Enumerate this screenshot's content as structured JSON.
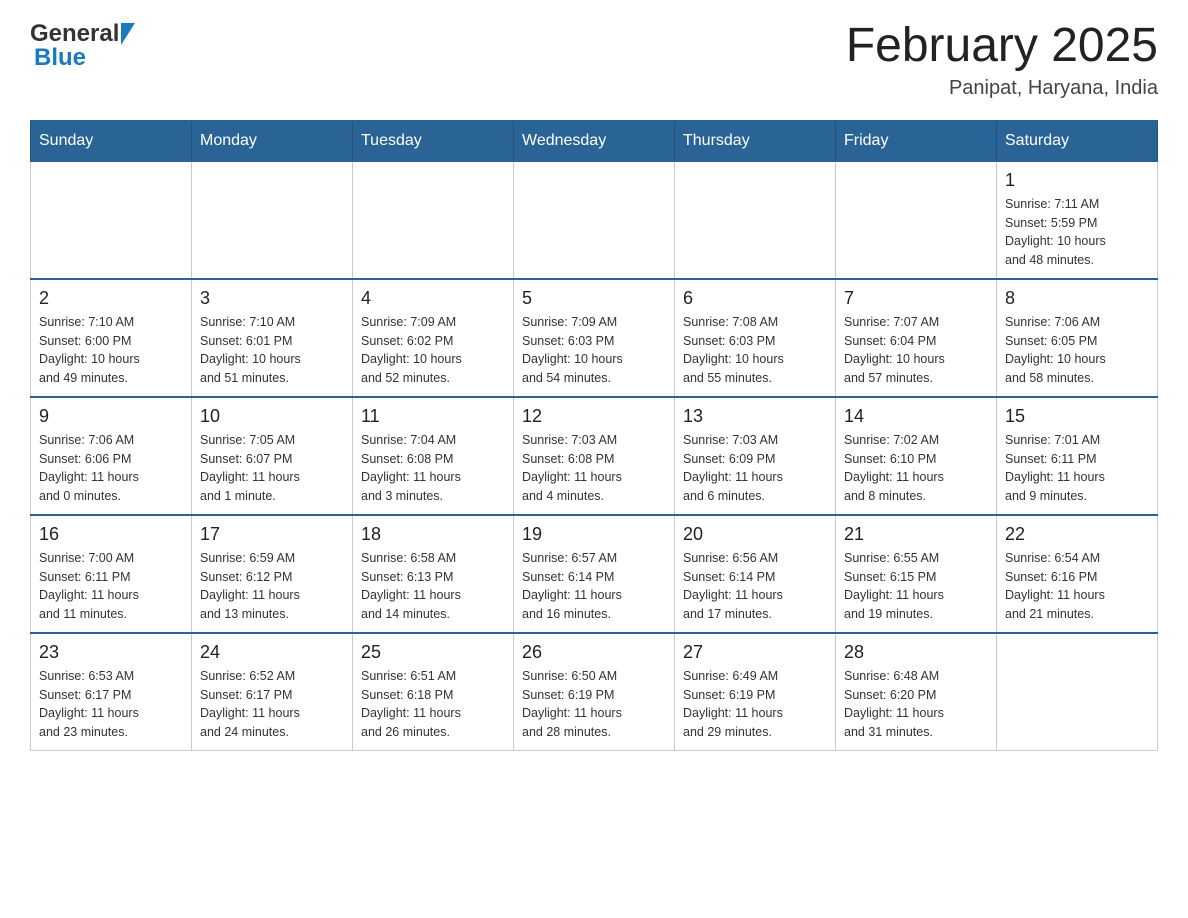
{
  "header": {
    "logo": {
      "general": "General",
      "blue": "Blue"
    },
    "title": "February 2025",
    "location": "Panipat, Haryana, India"
  },
  "weekdays": [
    "Sunday",
    "Monday",
    "Tuesday",
    "Wednesday",
    "Thursday",
    "Friday",
    "Saturday"
  ],
  "weeks": [
    [
      {
        "day": "",
        "info": ""
      },
      {
        "day": "",
        "info": ""
      },
      {
        "day": "",
        "info": ""
      },
      {
        "day": "",
        "info": ""
      },
      {
        "day": "",
        "info": ""
      },
      {
        "day": "",
        "info": ""
      },
      {
        "day": "1",
        "info": "Sunrise: 7:11 AM\nSunset: 5:59 PM\nDaylight: 10 hours\nand 48 minutes."
      }
    ],
    [
      {
        "day": "2",
        "info": "Sunrise: 7:10 AM\nSunset: 6:00 PM\nDaylight: 10 hours\nand 49 minutes."
      },
      {
        "day": "3",
        "info": "Sunrise: 7:10 AM\nSunset: 6:01 PM\nDaylight: 10 hours\nand 51 minutes."
      },
      {
        "day": "4",
        "info": "Sunrise: 7:09 AM\nSunset: 6:02 PM\nDaylight: 10 hours\nand 52 minutes."
      },
      {
        "day": "5",
        "info": "Sunrise: 7:09 AM\nSunset: 6:03 PM\nDaylight: 10 hours\nand 54 minutes."
      },
      {
        "day": "6",
        "info": "Sunrise: 7:08 AM\nSunset: 6:03 PM\nDaylight: 10 hours\nand 55 minutes."
      },
      {
        "day": "7",
        "info": "Sunrise: 7:07 AM\nSunset: 6:04 PM\nDaylight: 10 hours\nand 57 minutes."
      },
      {
        "day": "8",
        "info": "Sunrise: 7:06 AM\nSunset: 6:05 PM\nDaylight: 10 hours\nand 58 minutes."
      }
    ],
    [
      {
        "day": "9",
        "info": "Sunrise: 7:06 AM\nSunset: 6:06 PM\nDaylight: 11 hours\nand 0 minutes."
      },
      {
        "day": "10",
        "info": "Sunrise: 7:05 AM\nSunset: 6:07 PM\nDaylight: 11 hours\nand 1 minute."
      },
      {
        "day": "11",
        "info": "Sunrise: 7:04 AM\nSunset: 6:08 PM\nDaylight: 11 hours\nand 3 minutes."
      },
      {
        "day": "12",
        "info": "Sunrise: 7:03 AM\nSunset: 6:08 PM\nDaylight: 11 hours\nand 4 minutes."
      },
      {
        "day": "13",
        "info": "Sunrise: 7:03 AM\nSunset: 6:09 PM\nDaylight: 11 hours\nand 6 minutes."
      },
      {
        "day": "14",
        "info": "Sunrise: 7:02 AM\nSunset: 6:10 PM\nDaylight: 11 hours\nand 8 minutes."
      },
      {
        "day": "15",
        "info": "Sunrise: 7:01 AM\nSunset: 6:11 PM\nDaylight: 11 hours\nand 9 minutes."
      }
    ],
    [
      {
        "day": "16",
        "info": "Sunrise: 7:00 AM\nSunset: 6:11 PM\nDaylight: 11 hours\nand 11 minutes."
      },
      {
        "day": "17",
        "info": "Sunrise: 6:59 AM\nSunset: 6:12 PM\nDaylight: 11 hours\nand 13 minutes."
      },
      {
        "day": "18",
        "info": "Sunrise: 6:58 AM\nSunset: 6:13 PM\nDaylight: 11 hours\nand 14 minutes."
      },
      {
        "day": "19",
        "info": "Sunrise: 6:57 AM\nSunset: 6:14 PM\nDaylight: 11 hours\nand 16 minutes."
      },
      {
        "day": "20",
        "info": "Sunrise: 6:56 AM\nSunset: 6:14 PM\nDaylight: 11 hours\nand 17 minutes."
      },
      {
        "day": "21",
        "info": "Sunrise: 6:55 AM\nSunset: 6:15 PM\nDaylight: 11 hours\nand 19 minutes."
      },
      {
        "day": "22",
        "info": "Sunrise: 6:54 AM\nSunset: 6:16 PM\nDaylight: 11 hours\nand 21 minutes."
      }
    ],
    [
      {
        "day": "23",
        "info": "Sunrise: 6:53 AM\nSunset: 6:17 PM\nDaylight: 11 hours\nand 23 minutes."
      },
      {
        "day": "24",
        "info": "Sunrise: 6:52 AM\nSunset: 6:17 PM\nDaylight: 11 hours\nand 24 minutes."
      },
      {
        "day": "25",
        "info": "Sunrise: 6:51 AM\nSunset: 6:18 PM\nDaylight: 11 hours\nand 26 minutes."
      },
      {
        "day": "26",
        "info": "Sunrise: 6:50 AM\nSunset: 6:19 PM\nDaylight: 11 hours\nand 28 minutes."
      },
      {
        "day": "27",
        "info": "Sunrise: 6:49 AM\nSunset: 6:19 PM\nDaylight: 11 hours\nand 29 minutes."
      },
      {
        "day": "28",
        "info": "Sunrise: 6:48 AM\nSunset: 6:20 PM\nDaylight: 11 hours\nand 31 minutes."
      },
      {
        "day": "",
        "info": ""
      }
    ]
  ]
}
